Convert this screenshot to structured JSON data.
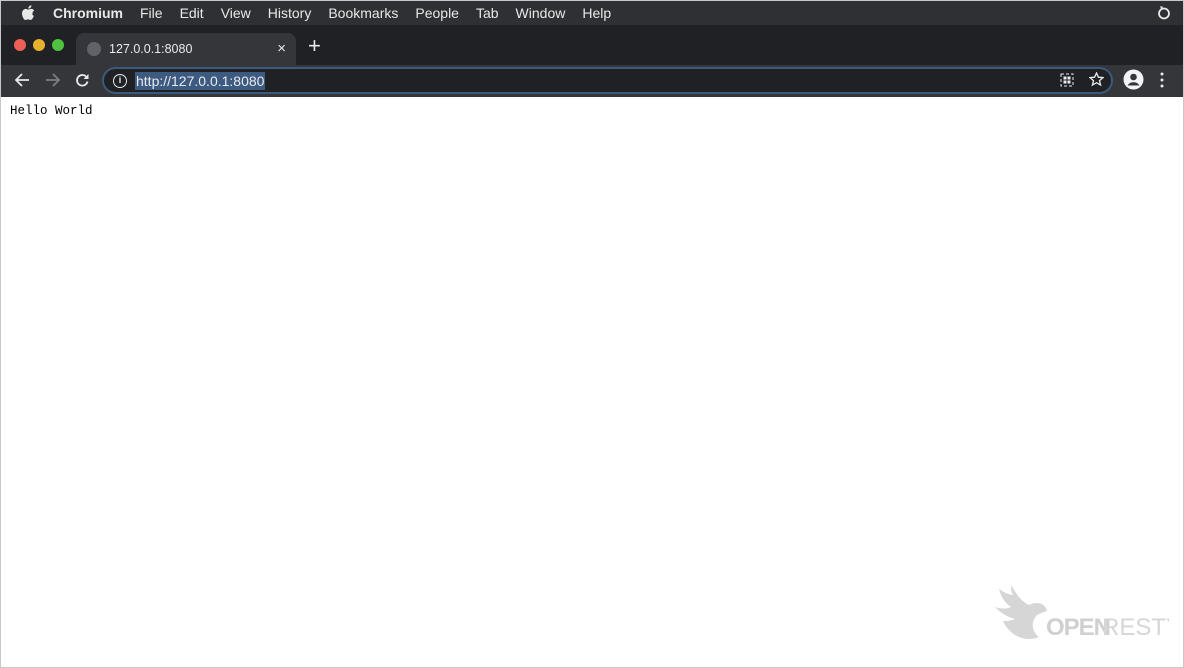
{
  "menubar": {
    "app": "Chromium",
    "items": [
      "File",
      "Edit",
      "View",
      "History",
      "Bookmarks",
      "People",
      "Tab",
      "Window",
      "Help"
    ]
  },
  "tab": {
    "title": "127.0.0.1:8080",
    "close": "×",
    "new_tab": "+"
  },
  "toolbar": {
    "url": "http://127.0.0.1:8080"
  },
  "page": {
    "text": "Hello World"
  },
  "watermark": {
    "text": "OPENRESTY"
  },
  "colors": {
    "traffic_red": "#ed5f57",
    "traffic_yellow": "#e6b12d",
    "traffic_green": "#4fc240",
    "url_highlight": "#3d5a80"
  }
}
